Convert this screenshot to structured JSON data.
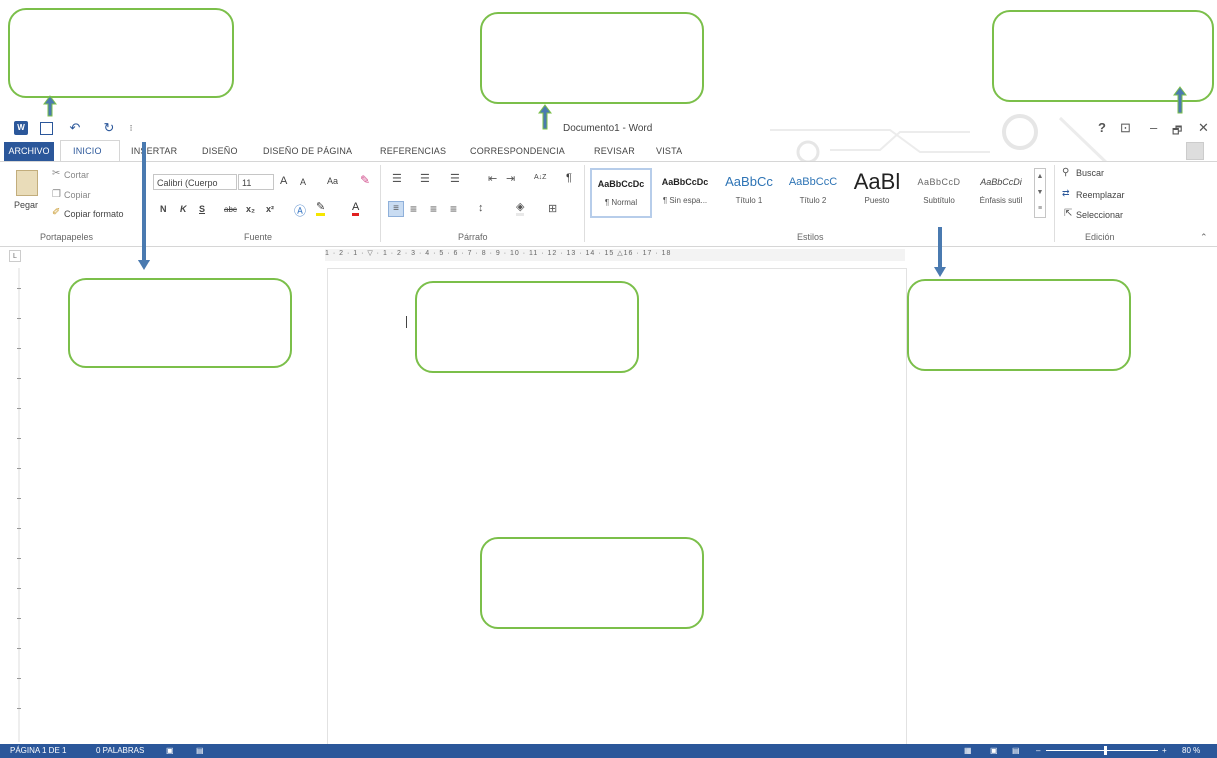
{
  "app": {
    "doc_title": "Documento1 - Word"
  },
  "quick_access": {
    "word_icon": "word-icon",
    "save_icon": "save-icon",
    "undo_icon": "undo-icon",
    "redo_icon": "redo-icon"
  },
  "window_controls": {
    "help": "?",
    "ribbon_opts": "⊡",
    "minimize": "–",
    "restore": "🗗",
    "close": "✕"
  },
  "tabs": [
    {
      "label": "ARCHIVO"
    },
    {
      "label": "INICIO"
    },
    {
      "label": "INSERTAR"
    },
    {
      "label": "DISEÑO"
    },
    {
      "label": "DISEÑO DE PÁGINA"
    },
    {
      "label": "REFERENCIAS"
    },
    {
      "label": "CORRESPONDENCIA"
    },
    {
      "label": "REVISAR"
    },
    {
      "label": "VISTA"
    }
  ],
  "clipboard": {
    "paste": "Pegar",
    "cut": "Cortar",
    "copy": "Copiar",
    "format_painter": "Copiar formato",
    "group": "Portapapeles"
  },
  "font": {
    "family": "Calibri (Cuerpo",
    "size": "11",
    "grow": "A",
    "shrink": "A",
    "case": "Aa",
    "bold": "N",
    "italic": "K",
    "underline": "S",
    "strike": "abc",
    "subscript": "x₂",
    "superscript": "x²",
    "group": "Fuente"
  },
  "paragraph": {
    "group": "Párrafo",
    "sort": "A↓Z",
    "pilcrow": "¶"
  },
  "styles": {
    "items": [
      {
        "preview": "AaBbCcDc",
        "name": "¶ Normal"
      },
      {
        "preview": "AaBbCcDc",
        "name": "¶ Sin espa..."
      },
      {
        "preview": "AaBbCc",
        "name": "Título 1"
      },
      {
        "preview": "AaBbCcC",
        "name": "Título 2"
      },
      {
        "preview": "AaBl",
        "name": "Puesto"
      },
      {
        "preview": "AaBbCcD",
        "name": "Subtítulo"
      },
      {
        "preview": "AaBbCcDi",
        "name": "Énfasis sutil"
      }
    ],
    "group": "Estilos"
  },
  "editing": {
    "find": "Buscar",
    "replace": "Reemplazar",
    "select": "Seleccionar",
    "group": "Edición"
  },
  "ruler": {
    "numbers": "1 · 2 · 1 · ▽ · 1 · 2 · 3 · 4 · 5 · 6 · 7 · 8 · 9 · 10 · 11 · 12 · 13 · 14 · 15 △16 · 17 · 18"
  },
  "status": {
    "page": "PÁGINA 1 DE 1",
    "words": "0 PALABRAS",
    "zoom": "80 %"
  },
  "colors": {
    "brand": "#2b579a",
    "annotation": "#7bbf4a",
    "arrow": "#4a7ab0"
  }
}
